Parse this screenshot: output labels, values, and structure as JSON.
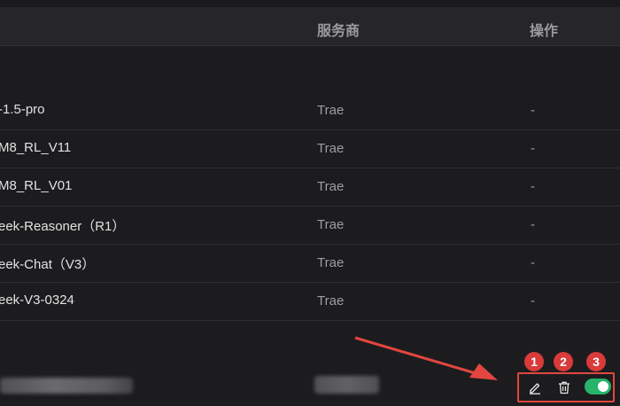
{
  "table": {
    "headers": {
      "provider": "服务商",
      "action": "操作"
    },
    "rows": [
      {
        "name": "-1.5-pro",
        "provider": "Trae",
        "action": "-"
      },
      {
        "name": "M8_RL_V11",
        "provider": "Trae",
        "action": "-"
      },
      {
        "name": "M8_RL_V01",
        "provider": "Trae",
        "action": "-"
      },
      {
        "name": "eek-Reasoner（R1）",
        "provider": "Trae",
        "action": "-"
      },
      {
        "name": "eek-Chat（V3）",
        "provider": "Trae",
        "action": "-"
      },
      {
        "name": "eek-V3-0324",
        "provider": "Trae",
        "action": "-"
      }
    ]
  },
  "annotations": {
    "badge_1": "1",
    "badge_2": "2",
    "badge_3": "3"
  },
  "custom_row": {
    "toggle_state": "on"
  },
  "icons": {
    "edit": "pencil-icon",
    "delete": "trash-icon",
    "toggle": "toggle-switch"
  },
  "colors": {
    "background": "#1c1c1f",
    "header_bg": "#262629",
    "toggle_on": "#27b36b",
    "annotation_red": "#e2463f",
    "badge_red": "#d93a3a"
  }
}
